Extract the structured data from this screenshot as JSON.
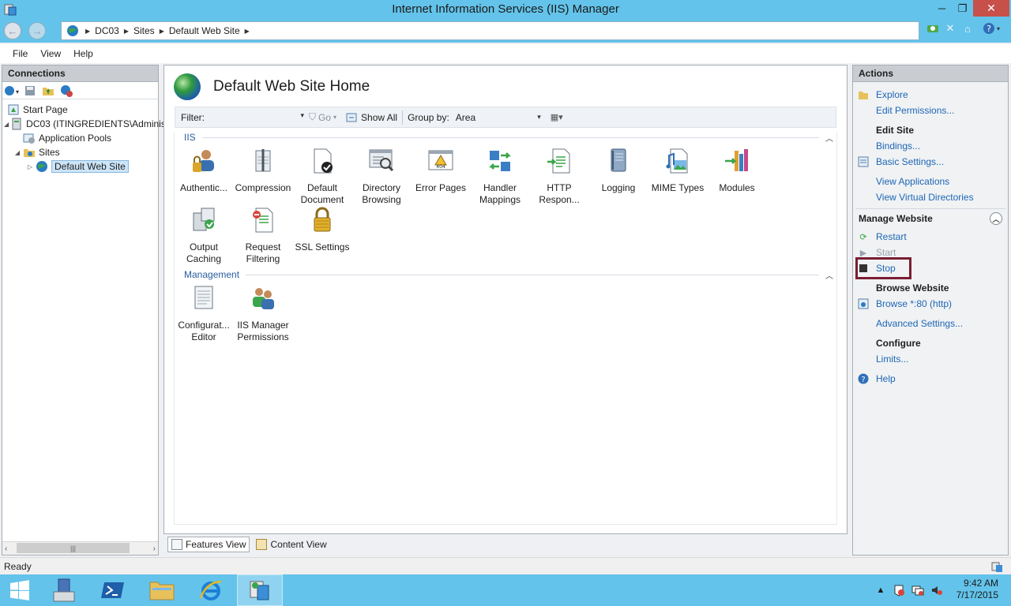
{
  "window": {
    "title": "Internet Information Services (IIS) Manager",
    "minimize_glyph": "─",
    "maximize_glyph": "❐",
    "close_glyph": "✕"
  },
  "address_bar": {
    "crumbs": [
      "DC03",
      "Sites",
      "Default Web Site"
    ]
  },
  "menu": {
    "items": [
      "File",
      "View",
      "Help"
    ]
  },
  "connections": {
    "title": "Connections",
    "tree": [
      {
        "label": "Start Page",
        "icon": "start-page-icon"
      },
      {
        "label": "DC03 (ITINGREDIENTS\\Administ",
        "icon": "server-icon"
      },
      {
        "label": "Application Pools",
        "icon": "app-pools-icon"
      },
      {
        "label": "Sites",
        "icon": "sites-folder-icon"
      },
      {
        "label": "Default Web Site",
        "icon": "globe-icon"
      }
    ]
  },
  "center": {
    "title": "Default Web Site Home",
    "filter_label": "Filter:",
    "go_label": "Go",
    "show_all_label": "Show All",
    "group_by_label": "Group by:",
    "group_by_value": "Area",
    "sections": {
      "iis": "IIS",
      "management": "Management"
    },
    "iis_features": [
      {
        "label": "Authentic...",
        "icon": "authentication-icon"
      },
      {
        "label": "Compression",
        "icon": "compression-icon"
      },
      {
        "label": "Default Document",
        "icon": "default-document-icon"
      },
      {
        "label": "Directory Browsing",
        "icon": "directory-browsing-icon"
      },
      {
        "label": "Error Pages",
        "icon": "error-pages-icon"
      },
      {
        "label": "Handler Mappings",
        "icon": "handler-mappings-icon"
      },
      {
        "label": "HTTP Respon...",
        "icon": "http-response-icon"
      },
      {
        "label": "Logging",
        "icon": "logging-icon"
      },
      {
        "label": "MIME Types",
        "icon": "mime-types-icon"
      },
      {
        "label": "Modules",
        "icon": "modules-icon"
      },
      {
        "label": "Output Caching",
        "icon": "output-caching-icon"
      },
      {
        "label": "Request Filtering",
        "icon": "request-filtering-icon"
      },
      {
        "label": "SSL Settings",
        "icon": "ssl-settings-icon"
      }
    ],
    "management_features": [
      {
        "label": "Configurat... Editor",
        "icon": "configuration-editor-icon"
      },
      {
        "label": "IIS Manager Permissions",
        "icon": "iis-manager-permissions-icon"
      }
    ],
    "error_badge": "404"
  },
  "view_tabs": {
    "features": "Features View",
    "content": "Content View"
  },
  "actions": {
    "title": "Actions",
    "explore": "Explore",
    "edit_permissions": "Edit Permissions...",
    "edit_site_header": "Edit Site",
    "bindings": "Bindings...",
    "basic_settings": "Basic Settings...",
    "view_applications": "View Applications",
    "view_virtual_directories": "View Virtual Directories",
    "manage_website_header": "Manage Website",
    "restart": "Restart",
    "start": "Start",
    "stop": "Stop",
    "browse_website_header": "Browse Website",
    "browse_80": "Browse *:80 (http)",
    "advanced_settings": "Advanced Settings...",
    "configure_header": "Configure",
    "limits": "Limits...",
    "help": "Help"
  },
  "status": {
    "text": "Ready"
  },
  "taskbar": {
    "time": "9:42 AM",
    "date": "7/17/2015"
  },
  "colors": {
    "titlebar": "#63c3ea",
    "link": "#1e66b4",
    "stop_highlight": "#7a1e32",
    "close_button": "#c7504a"
  }
}
